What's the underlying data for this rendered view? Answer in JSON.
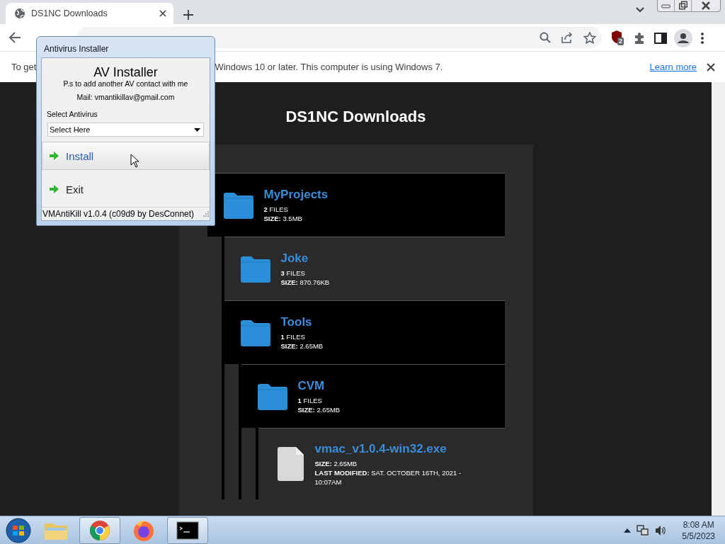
{
  "browser": {
    "tabs": [
      {
        "title": "DS1NC Downloads",
        "selected": true
      }
    ],
    "extension_badge": "2",
    "infobar": {
      "texts": [
        "To get",
        "Windows 10 or later. This computer is using Windows 7."
      ],
      "link": "Learn more"
    }
  },
  "page": {
    "heading": "DS1NC Downloads",
    "tree": [
      {
        "kind": "folder",
        "name": "MyProjects",
        "expanded": true,
        "meta": [
          "**2** FILES",
          "**SIZE:** 3.5MB"
        ],
        "children": [
          {
            "kind": "folder",
            "name": "Joke",
            "expanded": false,
            "meta": [
              "**3** FILES",
              "**SIZE:** 870.76KB"
            ]
          },
          {
            "kind": "folder",
            "name": "Tools",
            "expanded": true,
            "meta": [
              "**1** FILES",
              "**SIZE:** 2.65MB"
            ],
            "children": [
              {
                "kind": "folder",
                "name": "CVM",
                "expanded": true,
                "meta": [
                  "**1** FILES",
                  "**SIZE:** 2.65MB"
                ],
                "children": [
                  {
                    "kind": "file",
                    "name": "vmac_v1.0.4-win32.exe",
                    "meta": [
                      "**SIZE:** 2.65MB",
                      "**LAST MODIFIED:** SAT. OCTOBER 16TH, 2021 - 10:07AM"
                    ]
                  }
                ]
              }
            ]
          }
        ]
      }
    ]
  },
  "dialog": {
    "title": "Antivirus Installer",
    "heading": "AV Installer",
    "note": "P.s to add another AV contact with me",
    "mail": "Mail: vmantikillav@gmail.com",
    "select_label": "Select Antivirus",
    "select": {
      "value": "Select Here"
    },
    "buttons": [
      {
        "label": "Install",
        "hovered": true
      },
      {
        "label": "Exit",
        "hovered": false
      }
    ],
    "status": "VMAntiKill v1.0.4 (c09d9 by DesConnet)"
  },
  "taskbar": {
    "apps": [
      {
        "kind": "explorer",
        "running": false
      },
      {
        "kind": "chrome",
        "running": true
      },
      {
        "kind": "firefox",
        "running": false
      },
      {
        "kind": "console",
        "running": true
      }
    ],
    "time": "8:08 AM",
    "date": "5/5/2023"
  }
}
